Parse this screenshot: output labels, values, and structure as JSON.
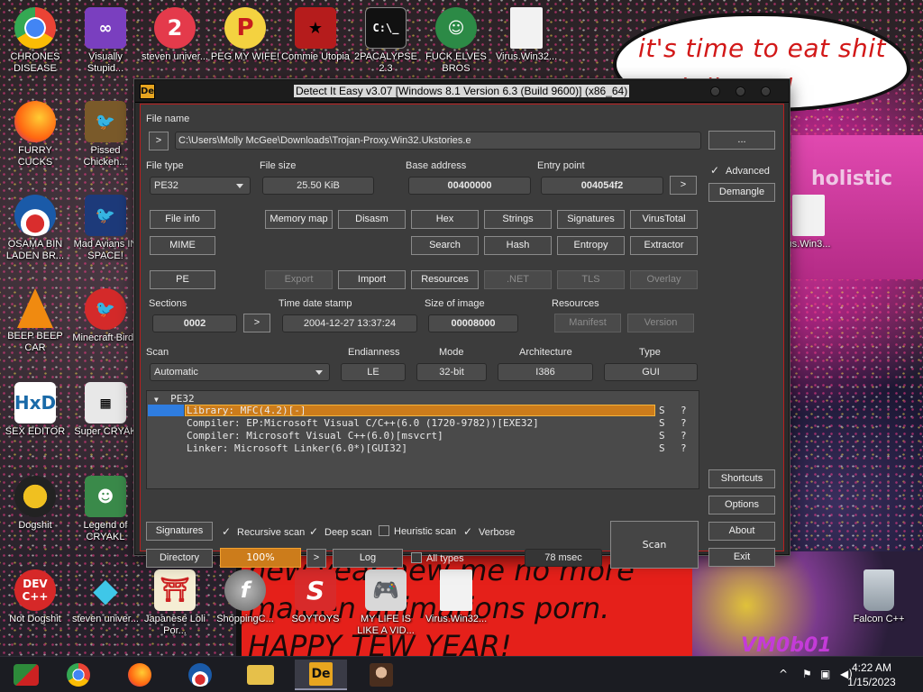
{
  "desktop": {
    "bubble_text": "it's time to eat shit and die and celebrate",
    "pink_text": "holistic",
    "banner_text": "new year new me no more maiden animations porn. HAPPY TEW YEAR!",
    "watermark": "VM0b01",
    "icons": [
      {
        "label": "CHRONES DISEASE",
        "icon": "chrome-icon"
      },
      {
        "label": "Visually Stupid...",
        "icon": "visual-studio-icon"
      },
      {
        "label": "steven univer...",
        "icon": "steven-universe-icon"
      },
      {
        "label": "PEG MY WIFE!",
        "icon": "pizza-logo-icon"
      },
      {
        "label": "Commie Utopia",
        "icon": "commie-icon"
      },
      {
        "label": "2PACALYPSE 2.3",
        "icon": "terminal-icon"
      },
      {
        "label": "FUCK ELVES BROS",
        "icon": "santa-icon"
      },
      {
        "label": "Virus.Win32...",
        "icon": "file-icon"
      },
      {
        "label": "FURRY CUCKS",
        "icon": "firefox-icon"
      },
      {
        "label": "Pissed Chicken...",
        "icon": "angry-birds-seasons-icon"
      },
      {
        "label": "OSAMA BIN LADEN BR...",
        "icon": "obama-logo-icon"
      },
      {
        "label": "Mad Avians IN SPACE!",
        "icon": "angry-birds-space-icon"
      },
      {
        "label": "BEEP BEEP CAR",
        "icon": "vlc-icon"
      },
      {
        "label": "Minecraft Birds",
        "icon": "angry-birds-icon"
      },
      {
        "label": "SEX EDITOR",
        "icon": "hxd-icon"
      },
      {
        "label": "Super CRYAK",
        "icon": "pixel-game-icon"
      },
      {
        "label": "Dogshit",
        "icon": "dogshit-icon"
      },
      {
        "label": "Legend of CRYAKL",
        "icon": "legend-icon"
      },
      {
        "label": "Not Dogshit",
        "icon": "devcpp-icon"
      },
      {
        "label": "steven univer...",
        "icon": "diamond-icon"
      },
      {
        "label": "Japanese Loli Por...",
        "icon": "torii-icon"
      },
      {
        "label": "ShoppingC...",
        "icon": "flash-icon"
      },
      {
        "label": "SOYTOYS",
        "icon": "soytoys-icon"
      },
      {
        "label": "MY LIFE IS LIKE A VID...",
        "icon": "gamepad-icon"
      },
      {
        "label": "Virus.Win32...",
        "icon": "file-icon"
      },
      {
        "label": "Falcon C++",
        "icon": "recycle-bin-icon"
      },
      {
        "label": "us.Win3...",
        "icon": "file-icon"
      }
    ]
  },
  "window": {
    "app_icon": "De",
    "title": "Detect It Easy v3.07 [Windows 8.1 Version 6.3 (Build 9600)] (x86_64)",
    "file_name_label": "File name",
    "file_name_arrow": ">",
    "file_path": "C:\\Users\\Molly McGee\\Downloads\\Trojan-Proxy.Win32.Ukstories.e",
    "browse": "...",
    "file_type_label": "File type",
    "file_type": "PE32",
    "file_size_label": "File size",
    "file_size": "25.50 KiB",
    "base_address_label": "Base address",
    "base_address": "00400000",
    "entry_point_label": "Entry point",
    "entry_point": "004054f2",
    "entry_arrow": ">",
    "advanced_label": "Advanced",
    "demangle": "Demangle",
    "buttons_row1": [
      "File info",
      "Memory map",
      "Disasm",
      "Hex",
      "Strings",
      "Signatures",
      "VirusTotal"
    ],
    "buttons_row2": [
      "MIME",
      "Search",
      "Hash",
      "Entropy",
      "Extractor"
    ],
    "buttons_row3": {
      "pe": "PE",
      "export": "Export",
      "import": "Import",
      "resources": "Resources",
      "net": ".NET",
      "tls": "TLS",
      "overlay": "Overlay"
    },
    "sections_label": "Sections",
    "sections": "0002",
    "sections_arrow": ">",
    "time_label": "Time date stamp",
    "time": "2004-12-27 13:37:24",
    "size_image_label": "Size of image",
    "size_image": "00008000",
    "resources_label": "Resources",
    "manifest": "Manifest",
    "version": "Version",
    "scan_label": "Scan",
    "scan_mode": "Automatic",
    "endianness_label": "Endianness",
    "endianness": "LE",
    "mode_label": "Mode",
    "mode": "32-bit",
    "arch_label": "Architecture",
    "arch": "I386",
    "type_label": "Type",
    "type": "GUI",
    "tree": {
      "root": "PE32",
      "rows": [
        {
          "text": "Library: MFC(4.2)[-]",
          "s": "S",
          "q": "?"
        },
        {
          "text": "Compiler: EP:Microsoft Visual C/C++(6.0 (1720-9782))[EXE32]",
          "s": "S",
          "q": "?"
        },
        {
          "text": "Compiler: Microsoft Visual C++(6.0)[msvcrt]",
          "s": "S",
          "q": "?"
        },
        {
          "text": "Linker: Microsoft Linker(6.0*)[GUI32]",
          "s": "S",
          "q": "?"
        }
      ]
    },
    "shortcuts": "Shortcuts",
    "options": "Options",
    "about": "About",
    "exit": "Exit",
    "signatures_btn": "Signatures",
    "recursive": "Recursive scan",
    "deep": "Deep scan",
    "heuristic": "Heuristic scan",
    "verbose": "Verbose",
    "directory": "Directory",
    "progress": "100%",
    "progress_arrow": ">",
    "log": "Log",
    "all_types": "All types",
    "elapsed": "78 msec",
    "scan_btn": "Scan"
  },
  "taskbar": {
    "time": "4:22 AM",
    "date": "1/15/2023",
    "items": [
      "windows-start-icon",
      "chrome-icon",
      "firefox-icon",
      "obama-logo-icon",
      "file-explorer-icon",
      "die-icon",
      "portrait-icon"
    ]
  },
  "colors": {
    "accent": "#cc7c1b",
    "window_border": "#b81e1e",
    "panel": "#3c3c3c"
  }
}
